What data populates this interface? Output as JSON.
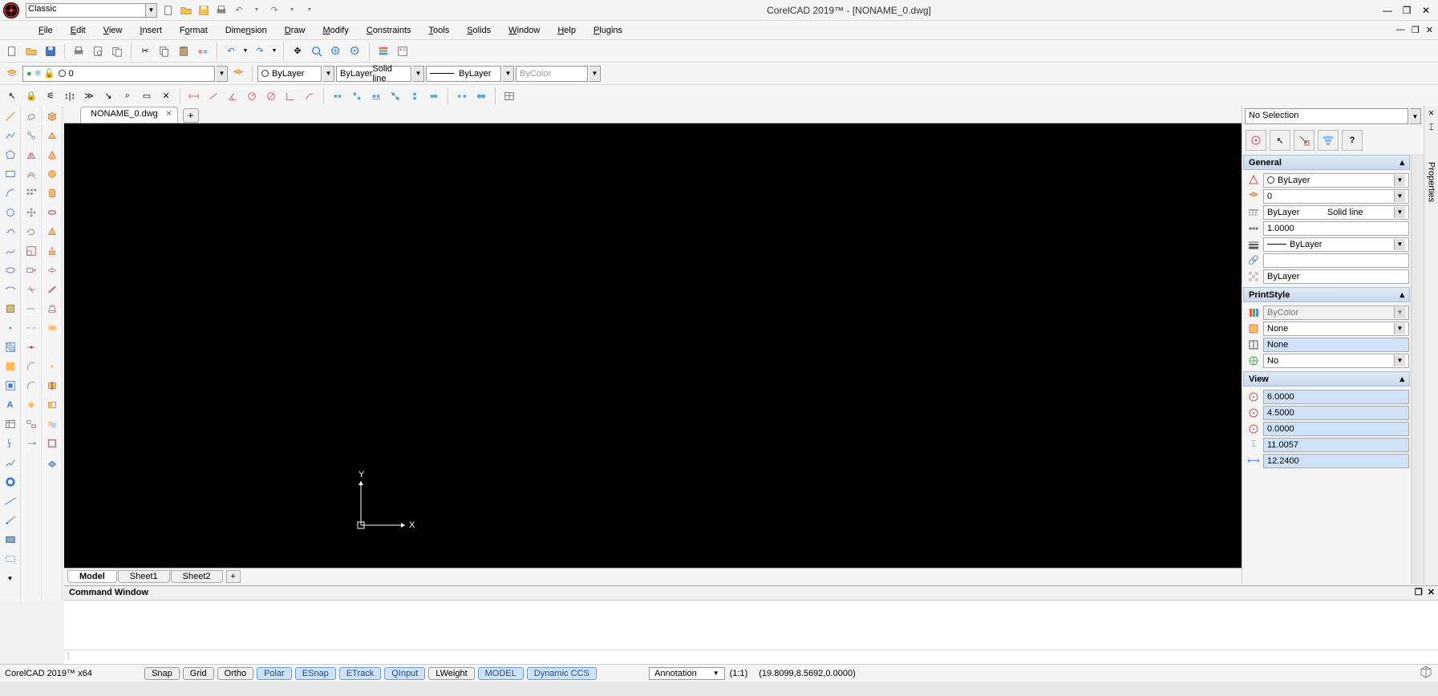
{
  "title": "CorelCAD 2019™ - [NONAME_0.dwg]",
  "workspace": "Classic",
  "menu": [
    "File",
    "Edit",
    "View",
    "Insert",
    "Format",
    "Dimension",
    "Draw",
    "Modify",
    "Constraints",
    "Tools",
    "Solids",
    "Window",
    "Help",
    "Plugins"
  ],
  "layer_combo": "0",
  "linecolor": "ByLayer",
  "linestyle_sel": "ByLayer",
  "linestyle_sub": "Solid line",
  "lineweight_sel": "ByLayer",
  "printcolor_sel": "ByColor",
  "doc_tab": "NONAME_0.dwg",
  "model_tabs": [
    "Model",
    "Sheet1",
    "Sheet2"
  ],
  "cmd_title": "Command Window",
  "cmd_prompt": ":",
  "status_left": "CorelCAD 2019™ x64",
  "status_buttons": [
    {
      "label": "Snap",
      "on": false
    },
    {
      "label": "Grid",
      "on": false
    },
    {
      "label": "Ortho",
      "on": false
    },
    {
      "label": "Polar",
      "on": true
    },
    {
      "label": "ESnap",
      "on": true
    },
    {
      "label": "ETrack",
      "on": true
    },
    {
      "label": "QInput",
      "on": true
    },
    {
      "label": "LWeight",
      "on": false
    },
    {
      "label": "MODEL",
      "on": true
    },
    {
      "label": "Dynamic CCS",
      "on": true
    }
  ],
  "status_anno": "Annotation",
  "status_scale": "(1:1)",
  "status_coords": "(19.8099,8.5692,0.0000)",
  "props": {
    "selection": "No Selection",
    "side_label": "Properties",
    "general": {
      "title": "General",
      "linecolor": "ByLayer",
      "layer": "0",
      "linestyle": "ByLayer",
      "linestyle_sub": "Solid line",
      "linescale": "1.0000",
      "lineweight": "ByLayer",
      "hyperlink": "",
      "transparency": "ByLayer"
    },
    "printstyle": {
      "title": "PrintStyle",
      "style": "ByColor",
      "stylesheet": "None",
      "table": "None",
      "attached": "No"
    },
    "view": {
      "title": "View",
      "v1": "6.0000",
      "v2": "4.5000",
      "v3": "0.0000",
      "v4": "11.0057",
      "v5": "12.2400"
    }
  }
}
